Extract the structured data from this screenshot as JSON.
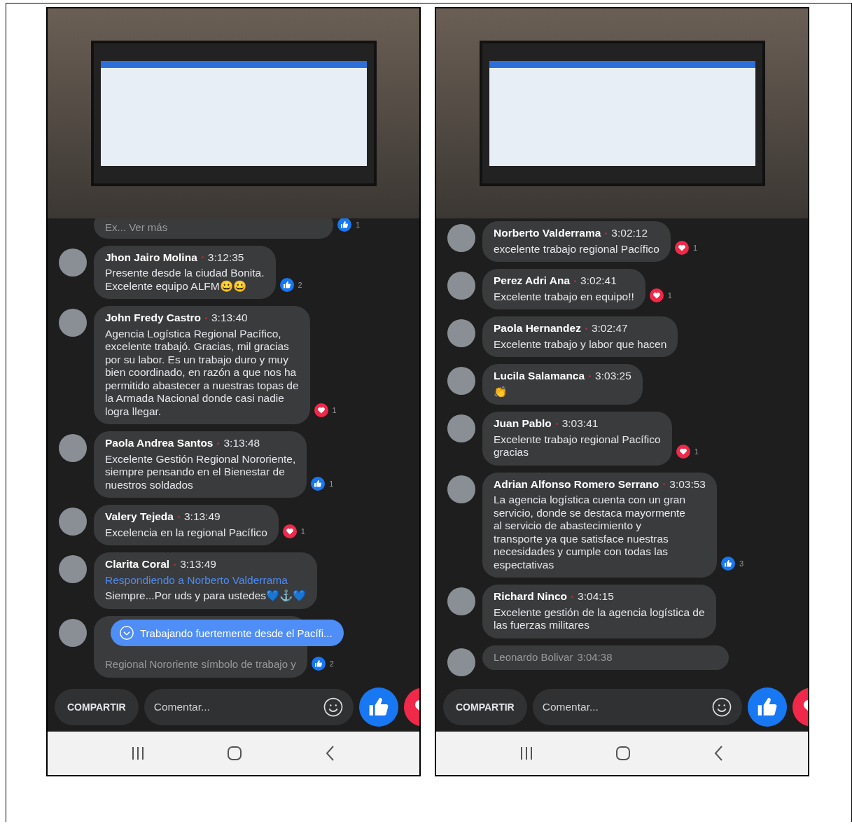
{
  "panels": [
    {
      "top_partial": {
        "text": "Ex... Ver más",
        "reaction": {
          "kind": "like",
          "count": "1"
        }
      },
      "comments": [
        {
          "name": "Jhon Jairo Molina",
          "time": "3:12:35",
          "text": "Presente desde la ciudad Bonita.\nExcelente equipo ALFM😀😀",
          "reaction": {
            "kind": "like",
            "count": "2"
          }
        },
        {
          "name": "John Fredy Castro",
          "time": "3:13:40",
          "text": "Agencia Logística Regional Pacífico,\nexcelente trabajó. Gracias, mil gracias\npor su labor. Es un trabajo duro y muy\nbien coordinado, en razón a que nos ha\npermitido abastecer a nuestras topas de\nla Armada Nacional donde casi nadie\nlogra llegar.",
          "reaction": {
            "kind": "love",
            "count": "1"
          }
        },
        {
          "name": "Paola Andrea Santos",
          "time": "3:13:48",
          "text": "Excelente Gestión Regional Nororiente,\nsiempre pensando en el Bienestar de\nnuestros soldados",
          "reaction": {
            "kind": "like",
            "count": "1"
          }
        },
        {
          "name": "Valery Tejeda",
          "time": "3:13:49",
          "text": "Excelencia en la regional Pacífico",
          "reaction": {
            "kind": "love",
            "count": "1"
          }
        },
        {
          "name": "Clarita Coral",
          "time": "3:13:49",
          "reply_to": "Respondiendo a Norberto Valderrama",
          "text": "Siempre...Por uds y para ustedes💙⚓💙"
        }
      ],
      "bottom_partial": {
        "text": "Regional Nororiente símbolo de trabajo y",
        "reaction": {
          "kind": "like",
          "count": "2"
        }
      },
      "toast": "Trabajando fuertemente desde el Pacífi...",
      "share": "COMPARTIR",
      "comment_placeholder": "Comentar..."
    },
    {
      "comments": [
        {
          "name": "Norberto Valderrama",
          "time": "3:02:12",
          "text": "excelente trabajo regional Pacífico",
          "reaction": {
            "kind": "love",
            "count": "1"
          }
        },
        {
          "name": "Perez Adri Ana",
          "time": "3:02:41",
          "text": "Excelente trabajo en equipo!!",
          "reaction": {
            "kind": "love",
            "count": "1"
          }
        },
        {
          "name": "Paola Hernandez",
          "time": "3:02:47",
          "text": "Excelente trabajo y labor que hacen"
        },
        {
          "name": "Lucila Salamanca",
          "time": "3:03:25",
          "text": "👏"
        },
        {
          "name": "Juan Pablo",
          "time": "3:03:41",
          "text": "Excelente trabajo regional Pacífico\ngracias",
          "reaction": {
            "kind": "love",
            "count": "1"
          }
        },
        {
          "name": "Adrian Alfonso Romero Serrano",
          "time": "3:03:53",
          "text": "La agencia logística cuenta con un gran\nservicio, donde se destaca mayormente\nal servicio de abastecimiento y\ntransporte ya que satisface nuestras\nnecesidades y cumple con todas las\nespectativas",
          "reaction": {
            "kind": "like",
            "count": "3"
          }
        },
        {
          "name": "Richard Ninco",
          "time": "3:04:15",
          "text": "Excelente gestión de la agencia logística de\nlas fuerzas militares"
        }
      ],
      "bottom_header": {
        "name": "Leonardo Bolivar",
        "time": "3:04:38"
      },
      "share": "COMPARTIR",
      "comment_placeholder": "Comentar..."
    }
  ]
}
